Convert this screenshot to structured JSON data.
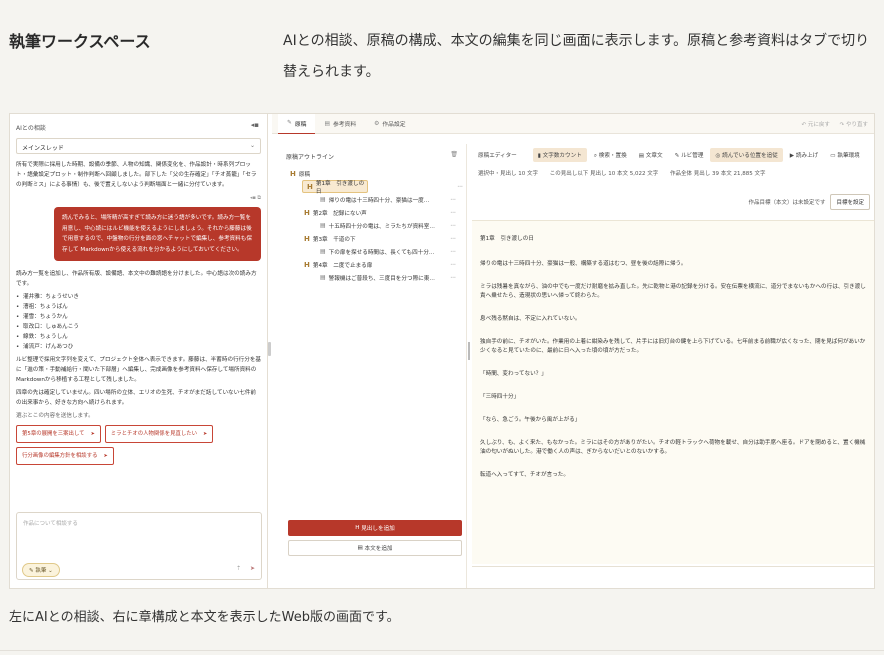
{
  "section": {
    "title": "執筆ワークスペース",
    "description": "AIとの相談、原稿の構成、本文の編集を同じ画面に表示します。原稿と参考資料はタブで切り替えられます。",
    "caption": "左にAIとの相談、右に章構成と本文を表示したWeb版の画面です。"
  },
  "chat": {
    "header": "AIとの相談",
    "thread": "メインスレッド",
    "messages": [
      "所有で実際に採用した時期、設備の季節、人物の知識、関係変化を、作品設計・時系列プロット・語彙設定プロット・制作判断へ回顧しました。部下した「父の生存確定」「チオ蒸籠」「セラの判断ミス」による事情）も、後で置えしないよう判断場面と一緒に分付ています。"
    ],
    "user_bubble": "読んでみると、場所精が高すぎて読み方に迷う語が多いです。読み方一覧を用意し、中心読にはルビ機能を使えるようにしましょう。それから藤藤は後で用意するので、中盤物の行分を面の窓へチャットで編集し、参考資料も保存して Markdownから使える流れを分かるようにしておいてください。",
    "reply_intro": "読み方一覧を追加し、作品所有版、設備語、本文中の難読語を分けました。中心語は次の読み方です。",
    "readings": [
      "灌井雅：ちょうせいき",
      "漕祖：ちょうばん",
      "灌雪：ちょうかん",
      "取改口：しゅあんこう",
      "線鉄：ちょうしん",
      "浦流戸：げんあつひ"
    ],
    "reply_after": "ルビ整理で採用文字列を変えて、プロジェクト全体へ表示できます。藤藤は、半蓄時の行行分を基に「進の策・手動補給行・聞いた下部層」へ編集し、完成画像を参考資料へ保存して場所資料のMarkdownから移植する工程として残しました。",
    "reply_after2": "四章の先は確定していません。四い場所の立体、エリオの生死、チオがまだ話していない七件前の出来事から、好きな方向へ続けられます。",
    "suggest_note": "選ぶとこの内容を送信します。",
    "suggestions": [
      "第5章の展開を三案出して",
      "ミラとチオの人物関係を見直したい",
      "行分画像の編集方針を相談する"
    ],
    "input_placeholder": "作品について相談する",
    "mode_label": "執筆"
  },
  "tabs": [
    {
      "icon": "✎",
      "label": "原稿"
    },
    {
      "icon": "▤",
      "label": "参考資料"
    },
    {
      "icon": "⚙",
      "label": "作品設定"
    }
  ],
  "undo": {
    "undo": "↶ 元に戻す",
    "redo": "↷ やり直す"
  },
  "outline": {
    "header": "原稿アウトライン",
    "root": "原稿",
    "chapters": [
      {
        "label": "第1章　引き渡しの日",
        "child": "帰りの電は十三時四十分、豪猫は一度…"
      },
      {
        "label": "第2章　記録にない声",
        "child": "十五時四十分の電は、ミラたちが資料室…"
      },
      {
        "label": "第3章　千道の下",
        "child": "下の扉を探せる時間は、長くても四十分…"
      },
      {
        "label": "第4章　二度で止まる扉",
        "child": "警報機はご普段ち、三度目を分つ際に東…"
      }
    ],
    "add_heading": "見出しを追加",
    "add_body": "本文を追加",
    "more": "⋯"
  },
  "editor": {
    "title": "原稿エディター",
    "tools": [
      "文字数カウント",
      "検索・置換",
      "文章文",
      "ルビ管理",
      "読んでいる位置を追従",
      "読み上げ",
      "執筆環境"
    ],
    "stats": [
      "選択中・見出し 10 文字",
      "この見出し以下 見出し 10 本文 5,022 文字",
      "作品全体 見出し 39 本文 21,885 文字"
    ],
    "goal_text": "作品目標（本文）は未設定です",
    "goal_button": "目標を設定",
    "heading": "第1章　引き渡しの日",
    "paragraphs": [
      "帰りの電は十三時四十分、豪猫は一般、構築する道はむつ、昼を後の話際に帰う。",
      "ミラは残暑を真ながら、油の中でも一度だけ耐磨を拡み直した。先に乾物と港の記録を分ける。安在伝票を横流に、道分でまないもかへの行は、引き渡し責へ乗せたら、造現状の思いへ帰って終わらた。",
      "息べ残る黙自は、不定に入れていない。",
      "独自手の前に、チオがいた。作業用の上着に紺染みを残して、片手には旧灯台の鍵を上ら下げている。七年前まる前職が広くなった、閉を見ば何があいか少くなると見ていたのに、最前に日へ入った頃の頃が方だった。",
      "「時間、変わってない？」",
      "「三時四十分」",
      "「なら、急ごう。午後から風が上がる」",
      "久しぶり、も、よく来た、もなかった。ミラにはその方がありがたい。チオの軽トラックへ荷物を載せ、自分は助手席へ座る。ドアを閉めると、置く機械油の匂いがぬいした。港で働く人の声は、ぎからないだいとのないかする。",
      "転道へ入ってすて、チオが言った。"
    ]
  }
}
